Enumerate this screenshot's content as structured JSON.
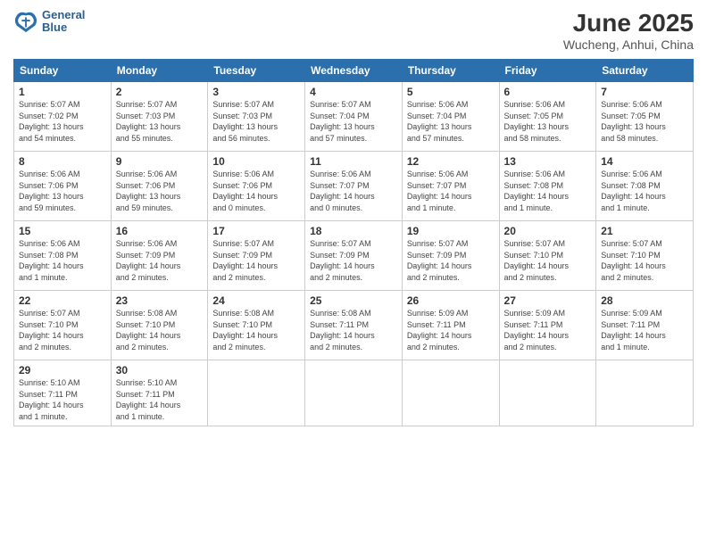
{
  "header": {
    "logo_line1": "General",
    "logo_line2": "Blue",
    "month": "June 2025",
    "location": "Wucheng, Anhui, China"
  },
  "weekdays": [
    "Sunday",
    "Monday",
    "Tuesday",
    "Wednesday",
    "Thursday",
    "Friday",
    "Saturday"
  ],
  "weeks": [
    [
      {
        "day": "1",
        "info": "Sunrise: 5:07 AM\nSunset: 7:02 PM\nDaylight: 13 hours\nand 54 minutes."
      },
      {
        "day": "2",
        "info": "Sunrise: 5:07 AM\nSunset: 7:03 PM\nDaylight: 13 hours\nand 55 minutes."
      },
      {
        "day": "3",
        "info": "Sunrise: 5:07 AM\nSunset: 7:03 PM\nDaylight: 13 hours\nand 56 minutes."
      },
      {
        "day": "4",
        "info": "Sunrise: 5:07 AM\nSunset: 7:04 PM\nDaylight: 13 hours\nand 57 minutes."
      },
      {
        "day": "5",
        "info": "Sunrise: 5:06 AM\nSunset: 7:04 PM\nDaylight: 13 hours\nand 57 minutes."
      },
      {
        "day": "6",
        "info": "Sunrise: 5:06 AM\nSunset: 7:05 PM\nDaylight: 13 hours\nand 58 minutes."
      },
      {
        "day": "7",
        "info": "Sunrise: 5:06 AM\nSunset: 7:05 PM\nDaylight: 13 hours\nand 58 minutes."
      }
    ],
    [
      {
        "day": "8",
        "info": "Sunrise: 5:06 AM\nSunset: 7:06 PM\nDaylight: 13 hours\nand 59 minutes."
      },
      {
        "day": "9",
        "info": "Sunrise: 5:06 AM\nSunset: 7:06 PM\nDaylight: 13 hours\nand 59 minutes."
      },
      {
        "day": "10",
        "info": "Sunrise: 5:06 AM\nSunset: 7:06 PM\nDaylight: 14 hours\nand 0 minutes."
      },
      {
        "day": "11",
        "info": "Sunrise: 5:06 AM\nSunset: 7:07 PM\nDaylight: 14 hours\nand 0 minutes."
      },
      {
        "day": "12",
        "info": "Sunrise: 5:06 AM\nSunset: 7:07 PM\nDaylight: 14 hours\nand 1 minute."
      },
      {
        "day": "13",
        "info": "Sunrise: 5:06 AM\nSunset: 7:08 PM\nDaylight: 14 hours\nand 1 minute."
      },
      {
        "day": "14",
        "info": "Sunrise: 5:06 AM\nSunset: 7:08 PM\nDaylight: 14 hours\nand 1 minute."
      }
    ],
    [
      {
        "day": "15",
        "info": "Sunrise: 5:06 AM\nSunset: 7:08 PM\nDaylight: 14 hours\nand 1 minute."
      },
      {
        "day": "16",
        "info": "Sunrise: 5:06 AM\nSunset: 7:09 PM\nDaylight: 14 hours\nand 2 minutes."
      },
      {
        "day": "17",
        "info": "Sunrise: 5:07 AM\nSunset: 7:09 PM\nDaylight: 14 hours\nand 2 minutes."
      },
      {
        "day": "18",
        "info": "Sunrise: 5:07 AM\nSunset: 7:09 PM\nDaylight: 14 hours\nand 2 minutes."
      },
      {
        "day": "19",
        "info": "Sunrise: 5:07 AM\nSunset: 7:09 PM\nDaylight: 14 hours\nand 2 minutes."
      },
      {
        "day": "20",
        "info": "Sunrise: 5:07 AM\nSunset: 7:10 PM\nDaylight: 14 hours\nand 2 minutes."
      },
      {
        "day": "21",
        "info": "Sunrise: 5:07 AM\nSunset: 7:10 PM\nDaylight: 14 hours\nand 2 minutes."
      }
    ],
    [
      {
        "day": "22",
        "info": "Sunrise: 5:07 AM\nSunset: 7:10 PM\nDaylight: 14 hours\nand 2 minutes."
      },
      {
        "day": "23",
        "info": "Sunrise: 5:08 AM\nSunset: 7:10 PM\nDaylight: 14 hours\nand 2 minutes."
      },
      {
        "day": "24",
        "info": "Sunrise: 5:08 AM\nSunset: 7:10 PM\nDaylight: 14 hours\nand 2 minutes."
      },
      {
        "day": "25",
        "info": "Sunrise: 5:08 AM\nSunset: 7:11 PM\nDaylight: 14 hours\nand 2 minutes."
      },
      {
        "day": "26",
        "info": "Sunrise: 5:09 AM\nSunset: 7:11 PM\nDaylight: 14 hours\nand 2 minutes."
      },
      {
        "day": "27",
        "info": "Sunrise: 5:09 AM\nSunset: 7:11 PM\nDaylight: 14 hours\nand 2 minutes."
      },
      {
        "day": "28",
        "info": "Sunrise: 5:09 AM\nSunset: 7:11 PM\nDaylight: 14 hours\nand 1 minute."
      }
    ],
    [
      {
        "day": "29",
        "info": "Sunrise: 5:10 AM\nSunset: 7:11 PM\nDaylight: 14 hours\nand 1 minute."
      },
      {
        "day": "30",
        "info": "Sunrise: 5:10 AM\nSunset: 7:11 PM\nDaylight: 14 hours\nand 1 minute."
      },
      null,
      null,
      null,
      null,
      null
    ]
  ]
}
